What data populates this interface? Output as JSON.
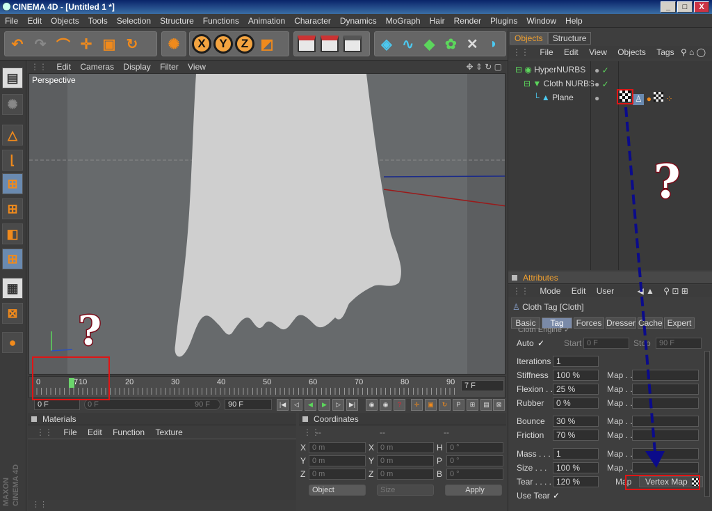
{
  "window": {
    "title": "CINEMA 4D - [Untitled 1 *]",
    "min": "_",
    "max": "□",
    "close": "X"
  },
  "menu": [
    "File",
    "Edit",
    "Objects",
    "Tools",
    "Selection",
    "Structure",
    "Functions",
    "Animation",
    "Character",
    "Dynamics",
    "MoGraph",
    "Hair",
    "Render",
    "Plugins",
    "Window",
    "Help"
  ],
  "toolbar": {
    "axis_x": "X",
    "axis_y": "Y",
    "axis_z": "Z"
  },
  "viewport": {
    "menu": [
      "Edit",
      "Cameras",
      "Display",
      "Filter",
      "View"
    ],
    "label": "Perspective"
  },
  "timeline": {
    "ticks": [
      "0",
      "10",
      "20",
      "30",
      "40",
      "50",
      "60",
      "70",
      "80",
      "90"
    ],
    "current_frame": "7",
    "frame_field": "7 F",
    "start_field": "0 F",
    "preview_start": "0 F",
    "preview_end": "90 F",
    "end_field": "90 F"
  },
  "materials": {
    "title": "Materials",
    "menu": [
      "File",
      "Edit",
      "Function",
      "Texture"
    ]
  },
  "coordinates": {
    "title": "Coordinates",
    "header": [
      "--",
      "--",
      "--"
    ],
    "rows": [
      {
        "a": "X",
        "av": "0 m",
        "b": "X",
        "bv": "0 m",
        "c": "H",
        "cv": "0 °"
      },
      {
        "a": "Y",
        "av": "0 m",
        "b": "Y",
        "bv": "0 m",
        "c": "P",
        "cv": "0 °"
      },
      {
        "a": "Z",
        "av": "0 m",
        "b": "Z",
        "bv": "0 m",
        "c": "B",
        "cv": "0 °"
      }
    ],
    "mode": "Object",
    "size_mode": "Size",
    "apply": "Apply"
  },
  "objects_panel": {
    "tabs": [
      "Objects",
      "Structure"
    ],
    "menu": [
      "File",
      "Edit",
      "View",
      "Objects",
      "Tags"
    ],
    "items": [
      {
        "name": "HyperNURBS"
      },
      {
        "name": "Cloth NURBS"
      },
      {
        "name": "Plane"
      }
    ]
  },
  "attributes": {
    "title": "Attributes",
    "menu": [
      "Mode",
      "Edit",
      "User"
    ],
    "object_title": "Cloth Tag [Cloth]",
    "tabs": [
      "Basic",
      "Tag",
      "Forces",
      "Dresser",
      "Cache",
      "Expert"
    ],
    "engine_label": "Cloth Engine ✓",
    "auto": {
      "label": "Auto",
      "check": "✓",
      "start_label": "Start",
      "start": "0 F",
      "stop_label": "Stop",
      "stop": "90 F"
    },
    "rows": [
      {
        "label": "Iterations",
        "value": "1",
        "map": ""
      },
      {
        "label": "Stiffness",
        "value": "100 %",
        "map": "Map . ."
      },
      {
        "label": "Flexion . .",
        "value": "25 %",
        "map": "Map . ."
      },
      {
        "label": "Rubber",
        "value": "0 %",
        "map": "Map . ."
      },
      {
        "label": "Bounce",
        "value": "30 %",
        "map": "Map . ."
      },
      {
        "label": "Friction",
        "value": "70 %",
        "map": "Map . ."
      },
      {
        "label": "Mass . . .",
        "value": "1",
        "map": "Map . ."
      },
      {
        "label": "Size . . .",
        "value": "100 %",
        "map": "Map . ."
      },
      {
        "label": "Tear . . . .",
        "value": "120 %",
        "map": "Map"
      }
    ],
    "vertex_map": "Vertex Map",
    "use_tear": {
      "label": "Use Tear",
      "check": "✓"
    }
  },
  "annotations": {
    "q1": "?",
    "q2": "?"
  },
  "logo": "MAXON CINEMA 4D",
  "colors": {
    "accent": "#f08a1c",
    "highlight_box": "#e01515",
    "arrow": "#0b0b8a"
  }
}
